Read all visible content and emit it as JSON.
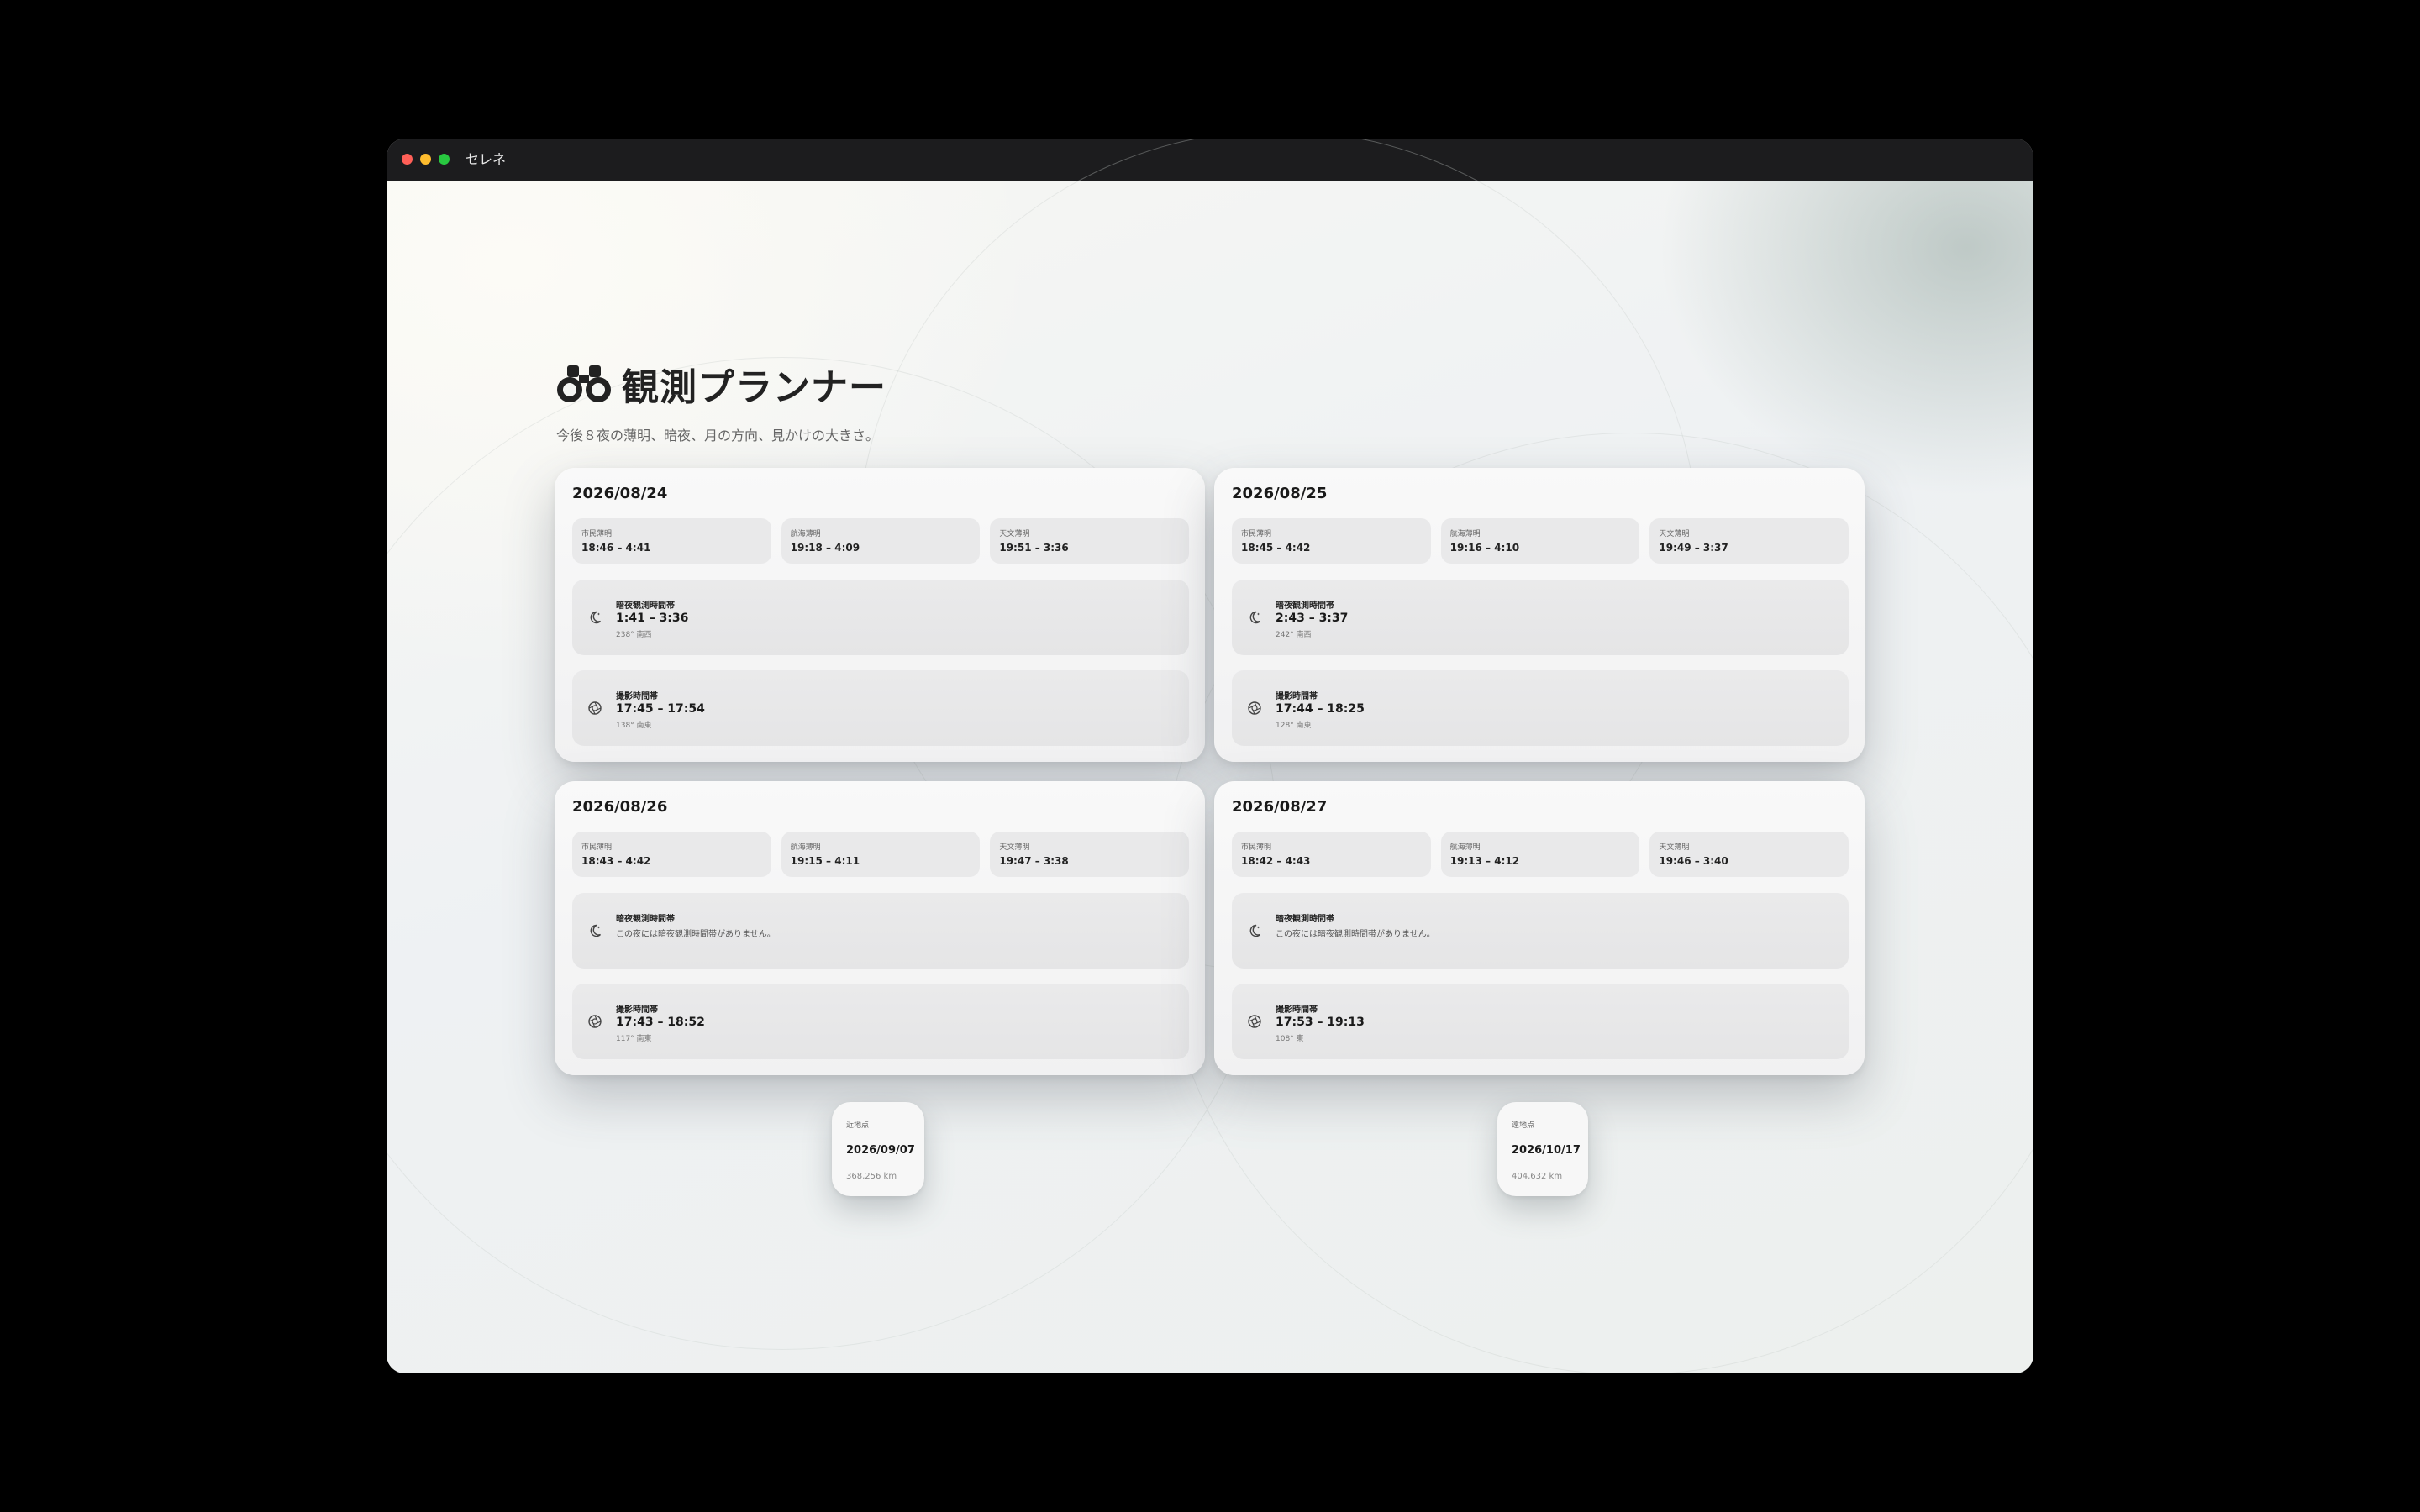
{
  "window": {
    "title": "セレネ"
  },
  "page": {
    "title": "観測プランナー",
    "subtitle": "今後８夜の薄明、暗夜、月の方向、見かけの大きさ。"
  },
  "nights": [
    {
      "date": "2026/08/24",
      "twilights": [
        {
          "label": "市民薄明",
          "value": "18:46 – 4:41"
        },
        {
          "label": "航海薄明",
          "value": "19:18 – 4:09"
        },
        {
          "label": "天文薄明",
          "value": "19:51 – 3:36"
        }
      ],
      "dark": {
        "label": "暗夜観測時間帯",
        "time": "1:41 – 3:36",
        "direction": "238° 南西"
      },
      "photo": {
        "label": "撮影時間帯",
        "time": "17:45 – 17:54",
        "direction": "138° 南東"
      }
    },
    {
      "date": "2026/08/25",
      "twilights": [
        {
          "label": "市民薄明",
          "value": "18:45 – 4:42"
        },
        {
          "label": "航海薄明",
          "value": "19:16 – 4:10"
        },
        {
          "label": "天文薄明",
          "value": "19:49 – 3:37"
        }
      ],
      "dark": {
        "label": "暗夜観測時間帯",
        "time": "2:43 – 3:37",
        "direction": "242° 南西"
      },
      "photo": {
        "label": "撮影時間帯",
        "time": "17:44 – 18:25",
        "direction": "128° 南東"
      }
    },
    {
      "date": "2026/08/26",
      "twilights": [
        {
          "label": "市民薄明",
          "value": "18:43 – 4:42"
        },
        {
          "label": "航海薄明",
          "value": "19:15 – 4:11"
        },
        {
          "label": "天文薄明",
          "value": "19:47 – 3:38"
        }
      ],
      "dark": {
        "label": "暗夜観測時間帯",
        "none": "この夜には暗夜観測時間帯がありません。"
      },
      "photo": {
        "label": "撮影時間帯",
        "time": "17:43 – 18:52",
        "direction": "117° 南東"
      }
    },
    {
      "date": "2026/08/27",
      "twilights": [
        {
          "label": "市民薄明",
          "value": "18:42 – 4:43"
        },
        {
          "label": "航海薄明",
          "value": "19:13 – 4:12"
        },
        {
          "label": "天文薄明",
          "value": "19:46 – 3:40"
        }
      ],
      "dark": {
        "label": "暗夜観測時間帯",
        "none": "この夜には暗夜観測時間帯がありません。"
      },
      "photo": {
        "label": "撮影時間帯",
        "time": "17:53 – 19:13",
        "direction": "108° 東"
      }
    }
  ],
  "apsides": [
    {
      "label": "近地点",
      "date": "2026/09/07",
      "distance": "368,256 km"
    },
    {
      "label": "遠地点",
      "date": "2026/10/17",
      "distance": "404,632 km"
    }
  ],
  "icons": {
    "title": "binoculars-icon",
    "dark": "moon-stars-icon",
    "photo": "aperture-icon"
  }
}
